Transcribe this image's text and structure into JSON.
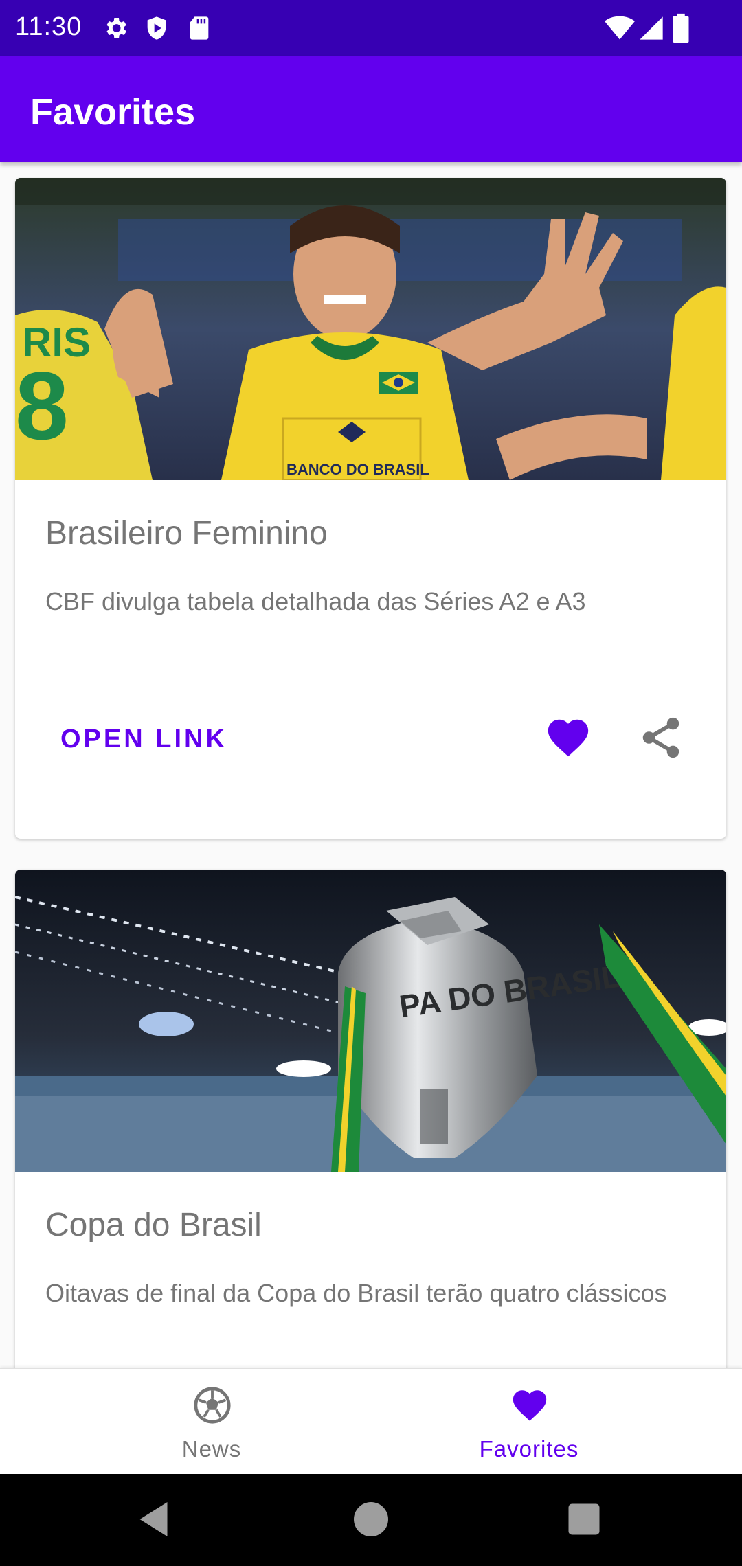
{
  "status_bar": {
    "time": "11:30"
  },
  "app_bar": {
    "title": "Favorites"
  },
  "cards": [
    {
      "title": "Brasileiro Feminino",
      "description": "CBF divulga tabela detalhada das Séries A2 e A3",
      "action_label": "OPEN LINK",
      "favorited": true
    },
    {
      "title": "Copa do Brasil",
      "description": "Oitavas de final da Copa do Brasil terão quatro clássicos"
    }
  ],
  "bottom_nav": {
    "items": [
      {
        "label": "News",
        "icon": "soccer-ball-icon",
        "selected": false
      },
      {
        "label": "Favorites",
        "icon": "heart-icon",
        "selected": true
      }
    ]
  },
  "colors": {
    "primary": "#6200ee",
    "primary_dark": "#3700b3",
    "text_secondary": "#757575"
  }
}
